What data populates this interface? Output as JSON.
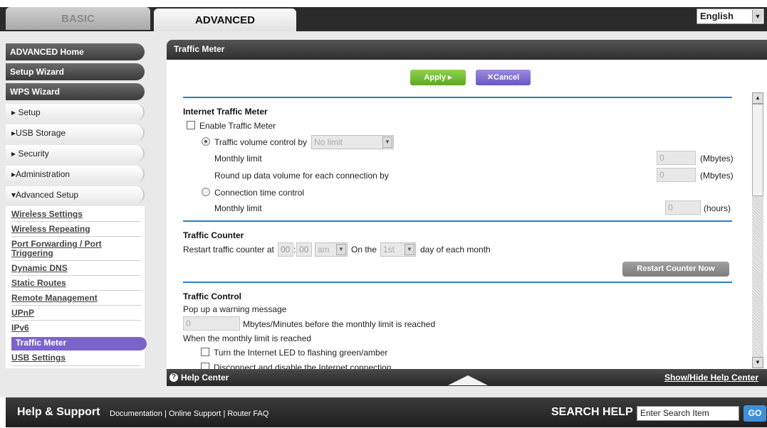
{
  "tabs": {
    "basic": "BASIC",
    "advanced": "ADVANCED"
  },
  "language": {
    "selected": "English"
  },
  "sidebar": {
    "main_items": [
      "ADVANCED Home",
      "Setup Wizard",
      "WPS Wizard"
    ],
    "sections": [
      "▸ Setup",
      "▸USB Storage",
      "▸ Security",
      "▸Administration",
      "▾Advanced Setup"
    ],
    "submenu": [
      "Wireless Settings",
      "Wireless Repeating",
      "Port Forwarding / Port Triggering",
      "Dynamic DNS",
      "Static Routes",
      "Remote Management",
      "UPnP",
      "IPv6",
      "Traffic Meter",
      "USB Settings"
    ],
    "active": "Traffic Meter"
  },
  "panel": {
    "title": "Traffic Meter",
    "apply_label": "Apply ▸",
    "cancel_label": "✕Cancel",
    "internet_meter": {
      "heading": "Internet Traffic Meter",
      "enable_label": "Enable Traffic Meter",
      "volume_label": "Traffic volume control by",
      "volume_select": "No limit",
      "monthly_limit_label": "Monthly limit",
      "monthly_limit_value": "0",
      "monthly_limit_unit": "(Mbytes)",
      "roundup_label": "Round up data volume for each connection by",
      "roundup_value": "0",
      "roundup_unit": "(Mbytes)",
      "conn_time_label": "Connection time control",
      "time_limit_label": "Monthly limit",
      "time_limit_value": "0",
      "time_limit_unit": "(hours)"
    },
    "traffic_counter": {
      "heading": "Traffic Counter",
      "restart_label": "Restart traffic counter at",
      "hour": "00",
      "minute": "00",
      "ampm": "am",
      "on_the_label": "On the",
      "day": "1st",
      "day_suffix": "day of each month",
      "restart_button": "Restart Counter Now"
    },
    "traffic_control": {
      "heading": "Traffic Control",
      "popup_label": "Pop up a warning message",
      "popup_value": "0",
      "popup_suffix": "Mbytes/Minutes before the monthly limit is reached",
      "when_label": "When the monthly limit is reached",
      "led_label": "Turn the Internet LED to flashing green/amber",
      "disconnect_label": "Disconnect and disable the Internet connection"
    }
  },
  "help_bar": {
    "left": "Help Center",
    "right": "Show/Hide Help Center"
  },
  "footer": {
    "title": "Help & Support",
    "links": [
      "Documentation",
      "Online Support",
      "Router FAQ"
    ],
    "search_label": "SEARCH HELP",
    "search_placeholder": "Enter Search Item",
    "go_label": "GO"
  }
}
